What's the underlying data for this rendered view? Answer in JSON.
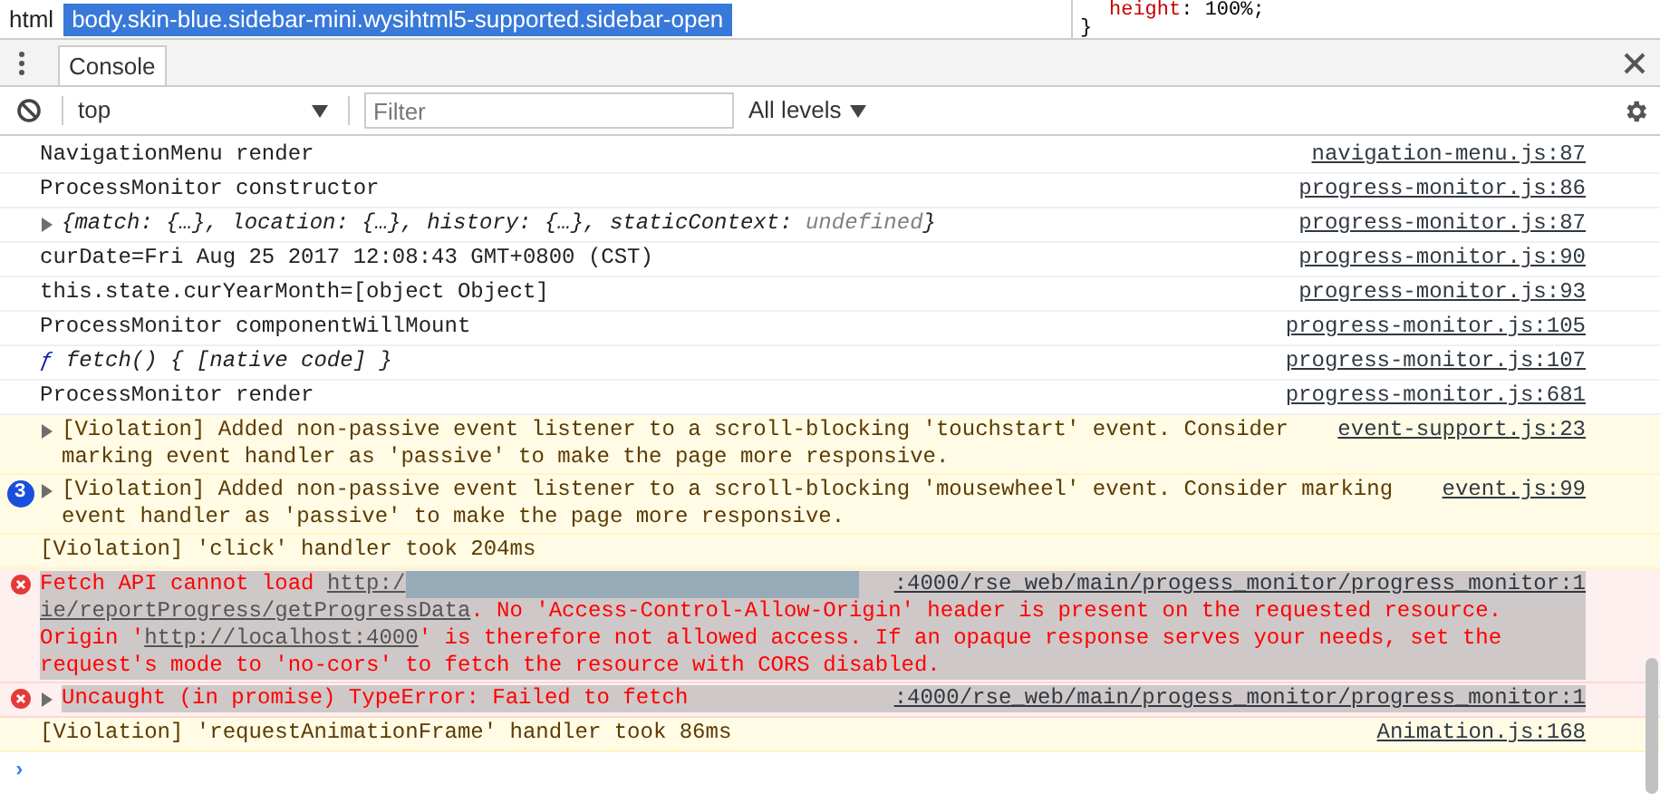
{
  "breadcrumb": {
    "items": [
      {
        "label": "html",
        "selected": false
      },
      {
        "label": "body.skin-blue.sidebar-mini.wysihtml5-supported.sidebar-open",
        "selected": true
      }
    ]
  },
  "styles_pane": {
    "property": "height",
    "separator": ":",
    "value": "100%;",
    "closing": "}"
  },
  "drawer": {
    "tabs": [
      {
        "label": "Console",
        "selected": true
      }
    ]
  },
  "toolbar": {
    "context": "top",
    "filter": {
      "placeholder": "Filter"
    },
    "levels": "All levels"
  },
  "messages": [
    {
      "kind": "log",
      "text": "NavigationMenu render",
      "source": "navigation-menu.js:87"
    },
    {
      "kind": "log",
      "text": "ProcessMonitor constructor",
      "source": "progress-monitor.js:86"
    },
    {
      "kind": "object",
      "expandable": true,
      "text": "{match: {…}, location: {…}, history: {…}, staticContext: ",
      "dim": "undefined",
      "close": "}",
      "source": "progress-monitor.js:87"
    },
    {
      "kind": "log",
      "text": "curDate=Fri Aug 25 2017 12:08:43 GMT+0800 (CST)",
      "source": "progress-monitor.js:90"
    },
    {
      "kind": "log",
      "text": "this.state.curYearMonth=[object Object]",
      "source": "progress-monitor.js:93"
    },
    {
      "kind": "log",
      "text": "ProcessMonitor componentWillMount",
      "source": "progress-monitor.js:105"
    },
    {
      "kind": "function",
      "keyword": "ƒ",
      "text": "fetch() { [native code] }",
      "source": "progress-monitor.js:107"
    },
    {
      "kind": "log",
      "text": "ProcessMonitor render",
      "source": "progress-monitor.js:681"
    },
    {
      "kind": "violation",
      "expandable": true,
      "text": "[Violation] Added non-passive event listener to a scroll-blocking 'touchstart' event. Consider marking event handler as 'passive' to make the page more responsive.",
      "source": "event-support.js:23"
    },
    {
      "kind": "violation",
      "expandable": true,
      "count": "3",
      "text": "[Violation] Added non-passive event listener to a scroll-blocking 'mousewheel' event. Consider marking event handler as 'passive' to make the page more responsive.",
      "source": "event.js:99"
    },
    {
      "kind": "violation",
      "expandable": false,
      "text": "[Violation] 'click' handler took 204ms"
    },
    {
      "kind": "error",
      "expandable": false,
      "highlighted": true,
      "redacted": true,
      "segments": [
        {
          "text": "Fetch API cannot load ",
          "link": false
        },
        {
          "text": "http:/",
          "link": true
        },
        {
          "text": "ie/reportProgress/getProgressData",
          "link": true
        },
        {
          "text": ". No 'Access-Control-Allow-Origin' header is present on the requested resource. Origin '",
          "link": false
        },
        {
          "text": "http://localhost:4000",
          "link": true
        },
        {
          "text": "' is therefore not allowed access. If an opaque response serves your needs, set the request's mode to 'no-cors' to fetch the resource with CORS disabled.",
          "link": false
        }
      ],
      "source": ":4000/rse_web/main/progess_monitor/progress_monitor:1"
    },
    {
      "kind": "error",
      "expandable": true,
      "highlighted": true,
      "redacted": false,
      "segments": [
        {
          "text": "Uncaught (in promise) TypeError: Failed to fetch",
          "link": false
        }
      ],
      "source": ":4000/rse_web/main/progess_monitor/progress_monitor:1"
    },
    {
      "kind": "violation",
      "expandable": false,
      "text": "[Violation] 'requestAnimationFrame' handler took 86ms",
      "source": "Animation.js:168"
    }
  ],
  "prompt": "›"
}
